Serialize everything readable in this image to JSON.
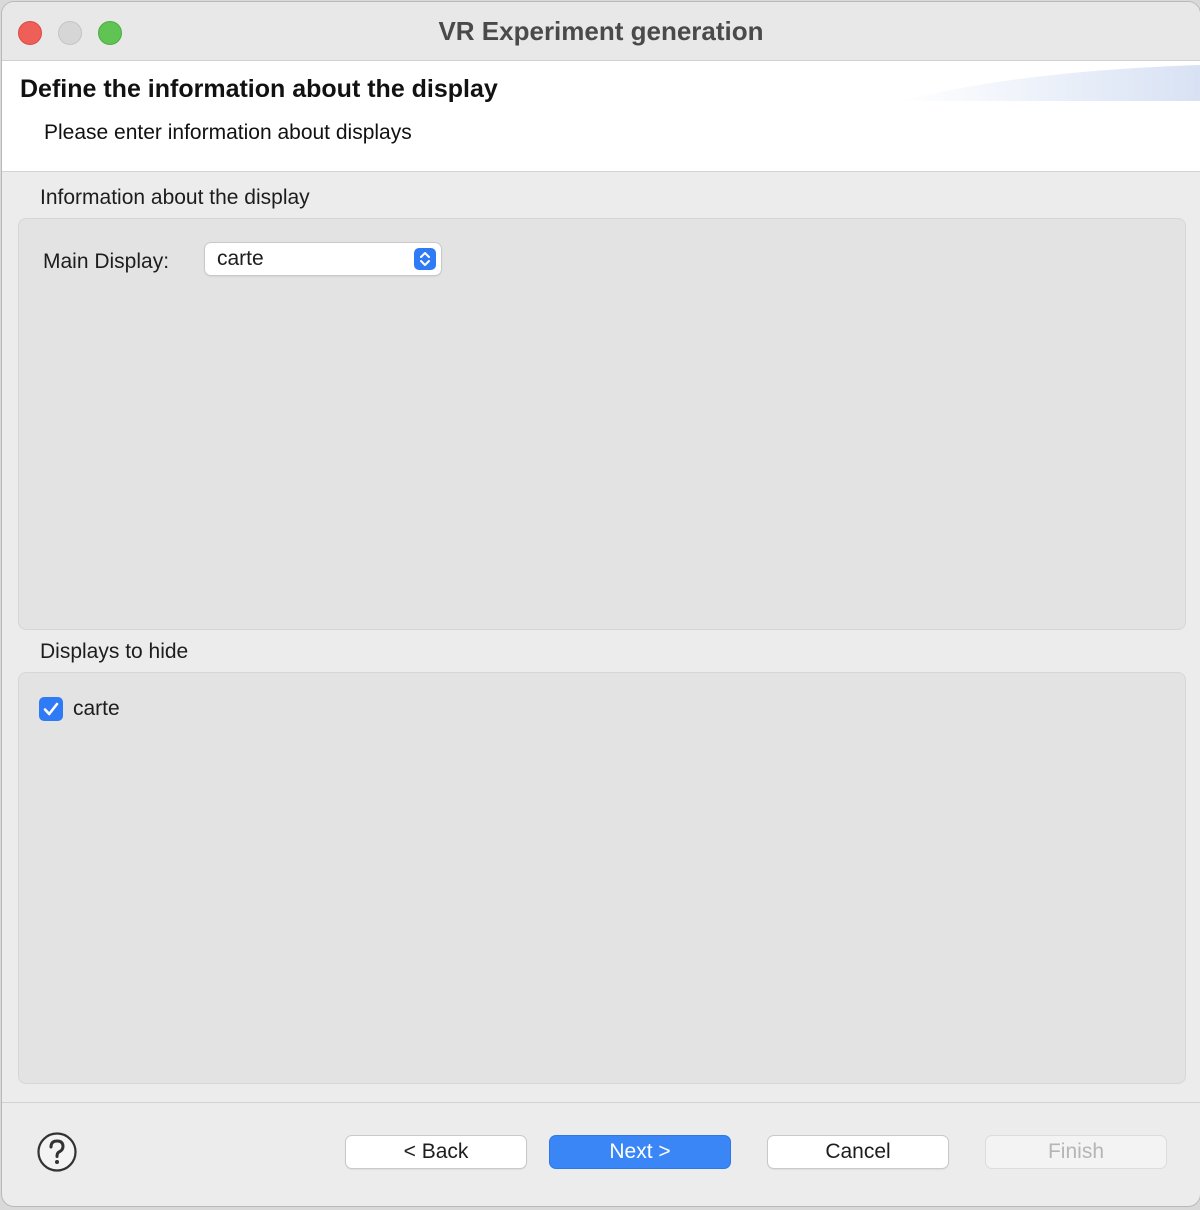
{
  "window": {
    "title": "VR Experiment generation"
  },
  "header": {
    "title": "Define the information about the display",
    "subtitle": "Please enter information about displays"
  },
  "display_section": {
    "label": "Information about the display",
    "main_display_label": "Main Display:",
    "main_display_value": "carte"
  },
  "hide_section": {
    "label": "Displays to hide",
    "items": [
      {
        "label": "carte",
        "checked": true
      }
    ]
  },
  "buttons": {
    "back": "< Back",
    "next": "Next >",
    "cancel": "Cancel",
    "finish": "Finish"
  },
  "icons": {
    "help": "help-icon",
    "select_arrows": "chevron-up-down-icon",
    "checkmark": "checkmark-icon"
  },
  "colors": {
    "accent": "#3a86f7",
    "close": "#ee5f57",
    "minimize": "#d6d6d6",
    "maximize": "#5fc453"
  }
}
